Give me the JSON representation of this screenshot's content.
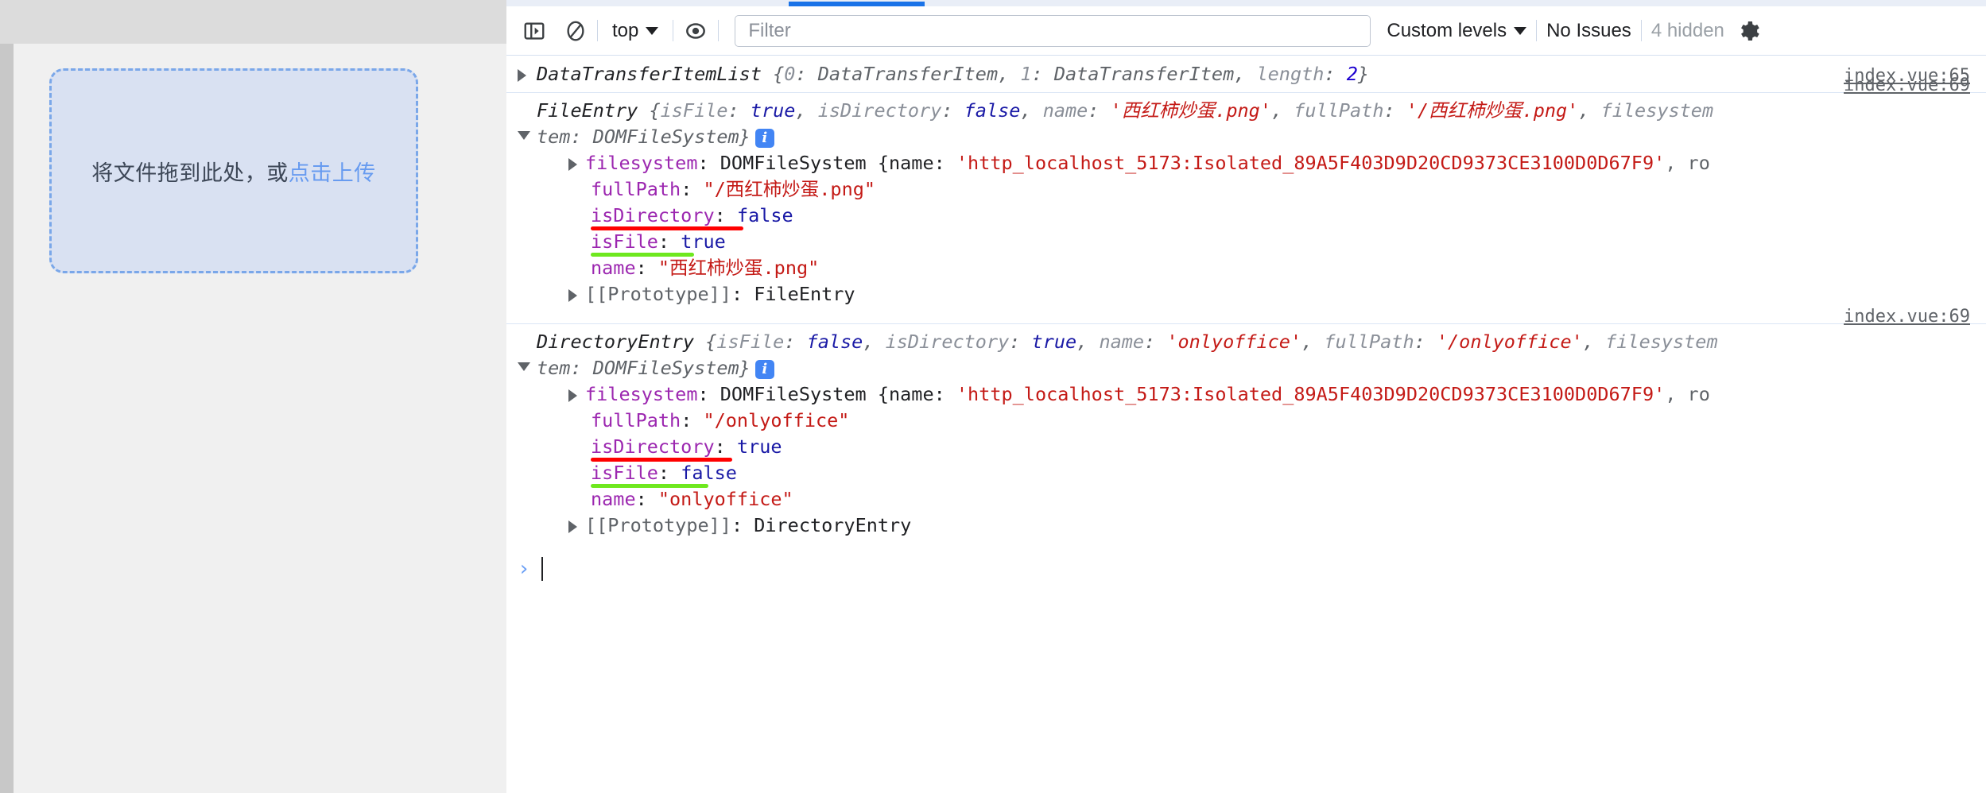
{
  "page": {
    "dropzone": {
      "text_main": "将文件拖到此处，或",
      "text_link": "点击上传"
    }
  },
  "devtools": {
    "toolbar": {
      "sidebar_toggle_icon": "show-console-sidebar-icon",
      "clear_icon": "clear-console-icon",
      "context_label": "top",
      "eye_icon": "live-expression-icon",
      "filter_placeholder": "Filter",
      "filter_value": "",
      "levels_label": "Custom levels",
      "issues_label": "No Issues",
      "hidden_label": "4 hidden",
      "settings_icon": "gear-icon"
    },
    "accent_color": "#1a73e8",
    "messages": [
      {
        "source": "index.vue:65",
        "preview": {
          "class": "DataTransferItemList",
          "open_brace": " {",
          "entries": [
            {
              "key": "0",
              "sep": ": ",
              "value": "DataTransferItem",
              "value_kind": "obj"
            },
            {
              "key": "1",
              "sep": ": ",
              "value": "DataTransferItem",
              "value_kind": "obj"
            },
            {
              "key": "length",
              "sep": ": ",
              "value": "2",
              "value_kind": "num"
            }
          ],
          "close_brace": "}"
        },
        "expanded": false
      },
      {
        "source": "index.vue:69",
        "preview": {
          "class": "FileEntry",
          "open_brace": " {",
          "entries": [
            {
              "key": "isFile",
              "sep": ": ",
              "value": "true",
              "value_kind": "bool"
            },
            {
              "key": "isDirectory",
              "sep": ": ",
              "value": "false",
              "value_kind": "bool"
            },
            {
              "key": "name",
              "sep": ": ",
              "value": "'西红柿炒蛋.png'",
              "value_kind": "str"
            },
            {
              "key": "fullPath",
              "sep": ": ",
              "value": "'/西红柿炒蛋.png'",
              "value_kind": "str"
            },
            {
              "key": "filesystem",
              "sep": ": ",
              "value": "DOMFileSystem",
              "value_kind": "obj"
            }
          ],
          "close_brace": "}",
          "info_badge": "i"
        },
        "expanded": true,
        "props": [
          {
            "indent": true,
            "triangle": "closed",
            "name": "filesystem",
            "text": ": DOMFileSystem {name: ",
            "str": "'http_localhost_5173:Isolated_89A5F403D9D20CD9373CE3100D0D67F9'",
            "tail": ", ro"
          },
          {
            "indent": false,
            "name": "fullPath",
            "text": ": ",
            "str": "\"/西红柿炒蛋.png\""
          },
          {
            "indent": false,
            "name": "isDirectory",
            "text": ": ",
            "bool": "false",
            "annotation": "red"
          },
          {
            "indent": false,
            "name": "isFile",
            "text": ": ",
            "bool": "true",
            "annotation": "green"
          },
          {
            "indent": false,
            "name": "name",
            "text": ": ",
            "str": "\"西红柿炒蛋.png\""
          },
          {
            "indent": true,
            "triangle": "closed",
            "plain": "[[Prototype]]",
            "text": ": ",
            "obj": "FileEntry"
          }
        ]
      },
      {
        "source": "index.vue:69",
        "preview": {
          "class": "DirectoryEntry",
          "open_brace": " {",
          "entries": [
            {
              "key": "isFile",
              "sep": ": ",
              "value": "false",
              "value_kind": "bool"
            },
            {
              "key": "isDirectory",
              "sep": ": ",
              "value": "true",
              "value_kind": "bool"
            },
            {
              "key": "name",
              "sep": ": ",
              "value": "'onlyoffice'",
              "value_kind": "str"
            },
            {
              "key": "fullPath",
              "sep": ": ",
              "value": "'/onlyoffice'",
              "value_kind": "str"
            },
            {
              "key": "filesystem",
              "sep": ": ",
              "value": "DOMFileSystem",
              "value_kind": "obj"
            }
          ],
          "close_brace": "}",
          "info_badge": "i"
        },
        "expanded": true,
        "props": [
          {
            "indent": true,
            "triangle": "closed",
            "name": "filesystem",
            "text": ": DOMFileSystem {name: ",
            "str": "'http_localhost_5173:Isolated_89A5F403D9D20CD9373CE3100D0D67F9'",
            "tail": ", ro"
          },
          {
            "indent": false,
            "name": "fullPath",
            "text": ": ",
            "str": "\"/onlyoffice\""
          },
          {
            "indent": false,
            "name": "isDirectory",
            "text": ": ",
            "bool": "true",
            "annotation": "red"
          },
          {
            "indent": false,
            "name": "isFile",
            "text": ": ",
            "bool": "false",
            "annotation": "green"
          },
          {
            "indent": false,
            "name": "name",
            "text": ": ",
            "str": "\"onlyoffice\""
          },
          {
            "indent": true,
            "triangle": "closed",
            "plain": "[[Prototype]]",
            "text": ": ",
            "obj": "DirectoryEntry"
          }
        ]
      }
    ],
    "prompt": {
      "caret": "›",
      "value": ""
    }
  }
}
